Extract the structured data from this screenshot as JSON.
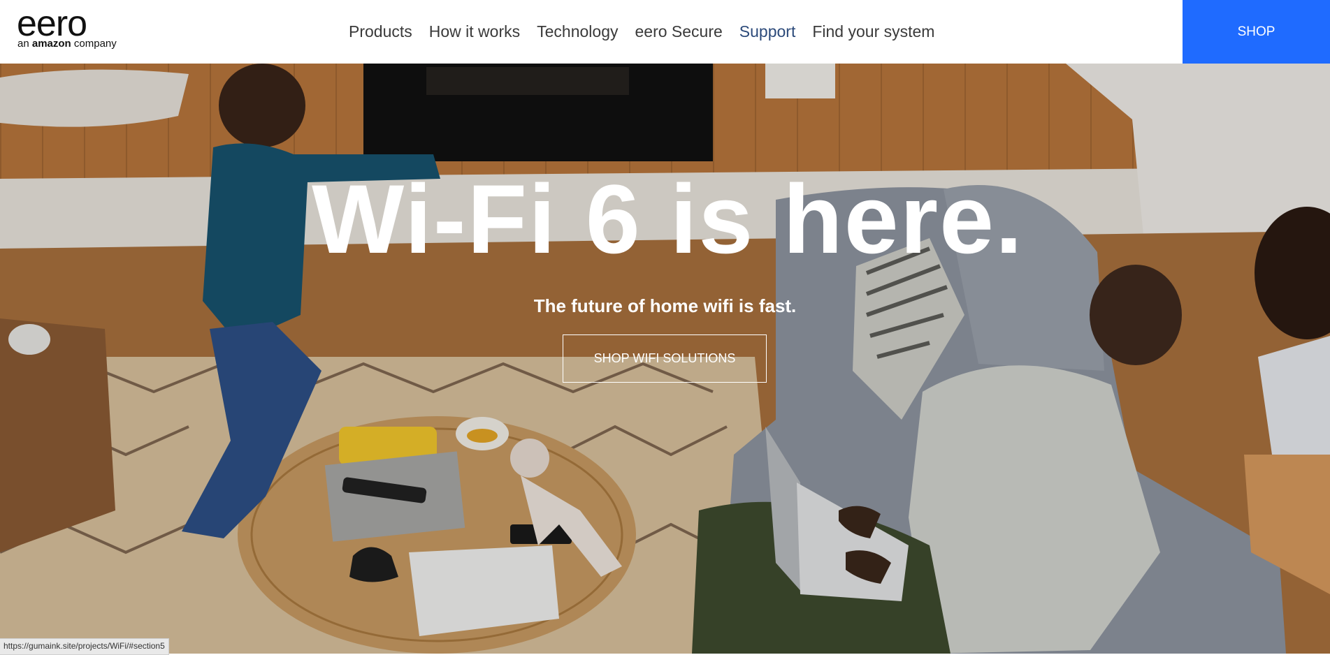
{
  "header": {
    "logo": {
      "word": "eero",
      "sub_prefix": "an ",
      "sub_brand": "amazon",
      "sub_suffix": " company"
    },
    "nav": [
      "Products",
      "How it works",
      "Technology",
      "eero Secure",
      "Support",
      "Find your system"
    ],
    "shop_label": "SHOP"
  },
  "hero": {
    "title": "Wi-Fi 6 is here.",
    "subtitle": "The future of home wifi is fast.",
    "cta_label": "SHOP WIFI SOLUTIONS"
  },
  "status_url": "https://gumaink.site/projects/WiFi/#section5",
  "colors": {
    "accent": "#1f6bff",
    "support_link": "#2c4a7a"
  }
}
